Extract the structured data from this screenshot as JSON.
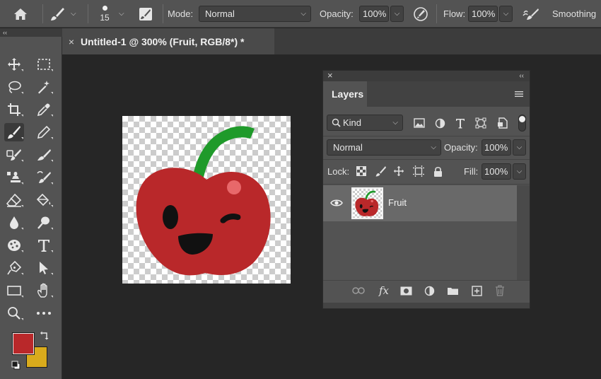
{
  "options_bar": {
    "brush_size": "15",
    "mode_label": "Mode:",
    "mode_value": "Normal",
    "opacity_label": "Opacity:",
    "opacity_value": "100%",
    "flow_label": "Flow:",
    "flow_value": "100%",
    "smoothing_label": "Smoothing"
  },
  "document": {
    "tab_title": "Untitled-1 @ 300% (Fruit, RGB/8*) *",
    "tab_close": "×"
  },
  "tools": {
    "collapse_glyph": "‹‹",
    "foreground_color": "#b9282a",
    "background_color": "#d9ab1c",
    "items": [
      "move-icon",
      "marquee-icon",
      "lasso-icon",
      "magic-wand-icon",
      "crop-icon",
      "eyedropper-icon",
      "brush-icon",
      "pencil-icon",
      "healing-brush-icon",
      "smudge-icon",
      "clone-stamp-icon",
      "history-brush-icon",
      "eraser-icon",
      "paint-bucket-icon",
      "blur-icon",
      "dodge-icon",
      "sponge-icon",
      "type-icon",
      "pen-icon",
      "path-selection-icon",
      "rectangle-icon",
      "hand-icon",
      "zoom-icon",
      "more-tools-icon"
    ]
  },
  "layers_panel": {
    "close_glyph": "×",
    "collapse_glyph": "‹‹",
    "tab_label": "Layers",
    "filter_kind": "Kind",
    "blend_mode": "Normal",
    "opacity_label": "Opacity:",
    "opacity_value": "100%",
    "lock_label": "Lock:",
    "fill_label": "Fill:",
    "fill_value": "100%",
    "layers": [
      {
        "name": "Fruit",
        "visible": true,
        "selected": true
      }
    ],
    "bottom_fx": "fx"
  },
  "colors": {
    "cherry_red": "#b9282a",
    "stem_green": "#1f9a2a",
    "highlight": "#e8686a"
  }
}
